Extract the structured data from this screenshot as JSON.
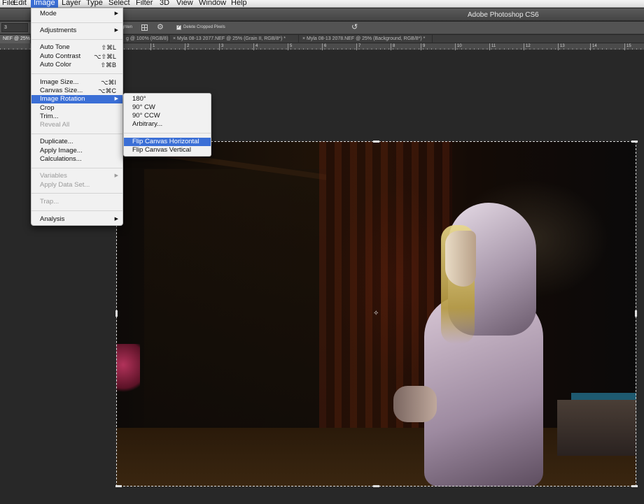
{
  "menubar": {
    "items": [
      {
        "label": "File",
        "active": false
      },
      {
        "label": "Edit",
        "active": false
      },
      {
        "label": "Image",
        "active": true
      },
      {
        "label": "Layer",
        "active": false
      },
      {
        "label": "Type",
        "active": false
      },
      {
        "label": "Select",
        "active": false
      },
      {
        "label": "Filter",
        "active": false
      },
      {
        "label": "3D",
        "active": false
      },
      {
        "label": "View",
        "active": false
      },
      {
        "label": "Window",
        "active": false
      },
      {
        "label": "Help",
        "active": false
      }
    ]
  },
  "titlebar": {
    "title": "Adobe Photoshop CS6"
  },
  "options": {
    "field_value": "3",
    "label_fragment": "ghten",
    "delete_cropped_label": "Delete Cropped Pixels",
    "delete_cropped_checked": true
  },
  "tabs": [
    {
      "label": "NEF @ 25% (R...",
      "active": true
    },
    {
      "label": "g @ 100% (RGB/8)",
      "active": false
    },
    {
      "label": "× Myla 08-13 2077.NEF @ 25% (Grain II, RGB/8*) *",
      "active": false
    },
    {
      "label": "× Myla 08-13 2078.NEF @ 25% (Background, RGB/8*) *",
      "active": false
    }
  ],
  "ruler": {
    "ticks": [
      "0",
      "1",
      "2",
      "3",
      "4",
      "5",
      "6",
      "7",
      "8",
      "9",
      "10",
      "11",
      "12",
      "13",
      "14",
      "15"
    ]
  },
  "image_menu": {
    "items": [
      {
        "label": "Mode",
        "shortcut": "",
        "submenu": true,
        "disabled": false,
        "highlighted": false
      },
      {
        "label": "Adjustments",
        "shortcut": "",
        "submenu": true,
        "disabled": false,
        "highlighted": false
      },
      {
        "label": "Auto Tone",
        "shortcut": "⇧⌘L",
        "submenu": false,
        "disabled": false,
        "highlighted": false
      },
      {
        "label": "Auto Contrast",
        "shortcut": "⌥⇧⌘L",
        "submenu": false,
        "disabled": false,
        "highlighted": false
      },
      {
        "label": "Auto Color",
        "shortcut": "⇧⌘B",
        "submenu": false,
        "disabled": false,
        "highlighted": false
      },
      {
        "label": "Image Size...",
        "shortcut": "⌥⌘I",
        "submenu": false,
        "disabled": false,
        "highlighted": false
      },
      {
        "label": "Canvas Size...",
        "shortcut": "⌥⌘C",
        "submenu": false,
        "disabled": false,
        "highlighted": false
      },
      {
        "label": "Image Rotation",
        "shortcut": "",
        "submenu": true,
        "disabled": false,
        "highlighted": true
      },
      {
        "label": "Crop",
        "shortcut": "",
        "submenu": false,
        "disabled": false,
        "highlighted": false
      },
      {
        "label": "Trim...",
        "shortcut": "",
        "submenu": false,
        "disabled": false,
        "highlighted": false
      },
      {
        "label": "Reveal All",
        "shortcut": "",
        "submenu": false,
        "disabled": true,
        "highlighted": false
      },
      {
        "label": "Duplicate...",
        "shortcut": "",
        "submenu": false,
        "disabled": false,
        "highlighted": false
      },
      {
        "label": "Apply Image...",
        "shortcut": "",
        "submenu": false,
        "disabled": false,
        "highlighted": false
      },
      {
        "label": "Calculations...",
        "shortcut": "",
        "submenu": false,
        "disabled": false,
        "highlighted": false
      },
      {
        "label": "Variables",
        "shortcut": "",
        "submenu": true,
        "disabled": true,
        "highlighted": false
      },
      {
        "label": "Apply Data Set...",
        "shortcut": "",
        "submenu": false,
        "disabled": true,
        "highlighted": false
      },
      {
        "label": "Trap...",
        "shortcut": "",
        "submenu": false,
        "disabled": true,
        "highlighted": false
      },
      {
        "label": "Analysis",
        "shortcut": "",
        "submenu": true,
        "disabled": false,
        "highlighted": false
      }
    ]
  },
  "rotation_submenu": {
    "items": [
      {
        "label": "180°",
        "highlighted": false
      },
      {
        "label": "90° CW",
        "highlighted": false
      },
      {
        "label": "90° CCW",
        "highlighted": false
      },
      {
        "label": "Arbitrary...",
        "highlighted": false
      },
      {
        "label": "Flip Canvas Horizontal",
        "highlighted": true
      },
      {
        "label": "Flip Canvas Vertical",
        "highlighted": false
      }
    ]
  },
  "colors": {
    "menu_highlight": "#3b6fd6",
    "menu_background": "#f1f1f1",
    "app_background": "#282828"
  }
}
